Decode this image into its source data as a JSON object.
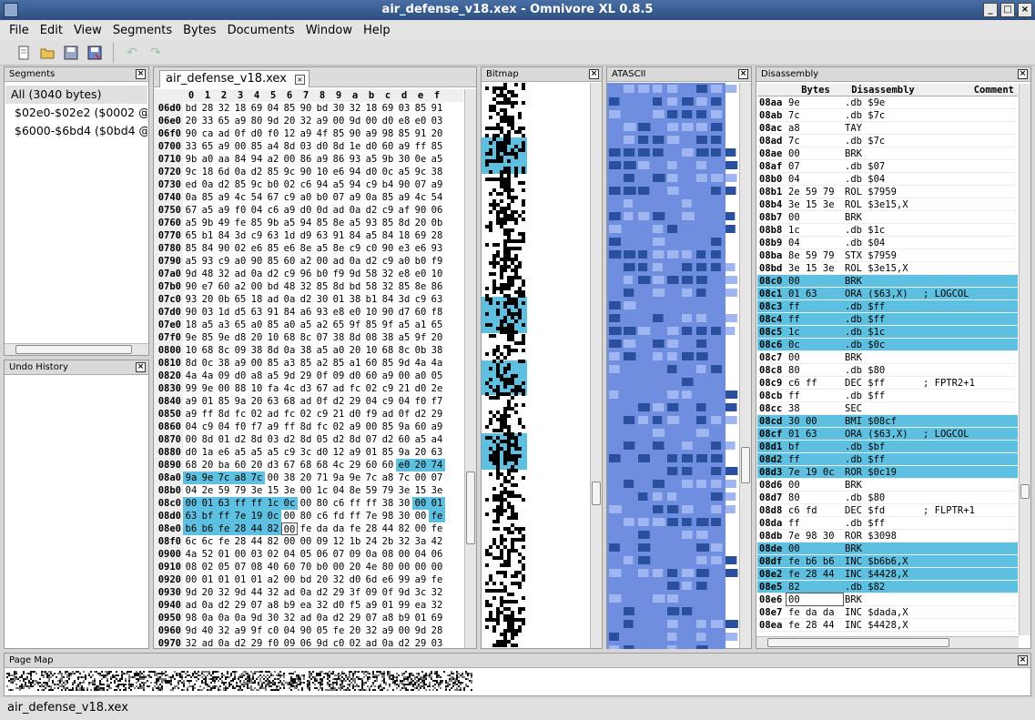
{
  "window": {
    "title": "air_defense_v18.xex - Omnivore XL 0.8.5"
  },
  "menu": [
    "File",
    "Edit",
    "View",
    "Segments",
    "Bytes",
    "Documents",
    "Window",
    "Help"
  ],
  "panels": {
    "segments": "Segments",
    "undo": "Undo History",
    "bitmap": "Bitmap",
    "atascii": "ATASCII",
    "disassembly": "Disassembly",
    "pagemap": "Page Map"
  },
  "segments": [
    "All (3040 bytes)",
    "$02e0-$02e2 ($0002 @",
    "$6000-$6bd4 ($0bd4 @"
  ],
  "editor_tab": "air_defense_v18.xex",
  "hex_columns": [
    "0",
    "1",
    "2",
    "3",
    "4",
    "5",
    "6",
    "7",
    "8",
    "9",
    "a",
    "b",
    "c",
    "d",
    "e",
    "f"
  ],
  "hex_rows": [
    {
      "addr": "06d0",
      "bytes": "bd 28 32 18 69 04 85 90 bd 30 32 18 69 03 85 91"
    },
    {
      "addr": "06e0",
      "bytes": "20 33 65 a9 80 9d 20 32 a9 00 9d 00 d0 e8 e0 03"
    },
    {
      "addr": "06f0",
      "bytes": "90 ca ad 0f d0 f0 12 a9 4f 85 90 a9 98 85 91 20"
    },
    {
      "addr": "0700",
      "bytes": "33 65 a9 00 85 a4 8d 03 d0 8d 1e d0 60 a9 ff 85"
    },
    {
      "addr": "0710",
      "bytes": "9b a0 aa 84 94 a2 00 86 a9 86 93 a5 9b 30 0e a5"
    },
    {
      "addr": "0720",
      "bytes": "9c 18 6d 0a d2 85 9c 90 10 e6 94 d0 0c a5 9c 38"
    },
    {
      "addr": "0730",
      "bytes": "ed 0a d2 85 9c b0 02 c6 94 a5 94 c9 b4 90 07 a9"
    },
    {
      "addr": "0740",
      "bytes": "0a 85 a9 4c 54 67 c9 a0 b0 07 a9 0a 85 a9 4c 54"
    },
    {
      "addr": "0750",
      "bytes": "67 a5 a9 f0 04 c6 a9 d0 0d ad 0a d2 c9 af 90 06"
    },
    {
      "addr": "0760",
      "bytes": "a5 9b 49 fe 85 9b a5 94 85 8e a5 93 85 8d 20 0b"
    },
    {
      "addr": "0770",
      "bytes": "65 b1 84 3d c9 63 1d d9 63 91 84 a5 84 18 69 28"
    },
    {
      "addr": "0780",
      "bytes": "85 84 90 02 e6 85 e6 8e a5 8e c9 c0 90 e3 e6 93"
    },
    {
      "addr": "0790",
      "bytes": "a5 93 c9 a0 90 85 60 a2 00 ad 0a d2 c9 a0 b0 f9"
    },
    {
      "addr": "07a0",
      "bytes": "9d 48 32 ad 0a d2 c9 96 b0 f9 9d 58 32 e8 e0 10"
    },
    {
      "addr": "07b0",
      "bytes": "90 e7 60 a2 00 bd 48 32 85 8d bd 58 32 85 8e 86"
    },
    {
      "addr": "07c0",
      "bytes": "93 20 0b 65 18 ad 0a d2 30 01 38 b1 84 3d c9 63"
    },
    {
      "addr": "07d0",
      "bytes": "90 03 1d d5 63 91 84 a6 93 e8 e0 10 90 d7 60 f8"
    },
    {
      "addr": "07e0",
      "bytes": "18 a5 a3 65 a0 85 a0 a5 a2 65 9f 85 9f a5 a1 65"
    },
    {
      "addr": "07f0",
      "bytes": "9e 85 9e d8 20 10 68 8c 07 38 8d 08 38 a5 9f 20"
    },
    {
      "addr": "0800",
      "bytes": "10 68 8c 09 38 8d 0a 38 a5 a0 20 10 68 8c 0b 38"
    },
    {
      "addr": "0810",
      "bytes": "8d 0c 38 a9 00 85 a3 85 a2 85 a1 60 85 9d 4a 4a"
    },
    {
      "addr": "0820",
      "bytes": "4a 4a 09 d0 a8 a5 9d 29 0f 09 d0 60 a9 00 a0 05"
    },
    {
      "addr": "0830",
      "bytes": "99 9e 00 88 10 fa 4c d3 67 ad fc 02 c9 21 d0 2e"
    },
    {
      "addr": "0840",
      "bytes": "a9 01 85 9a 20 63 68 ad 0f d2 29 04 c9 04 f0 f7"
    },
    {
      "addr": "0850",
      "bytes": "a9 ff 8d fc 02 ad fc 02 c9 21 d0 f9 ad 0f d2 29"
    },
    {
      "addr": "0860",
      "bytes": "04 c9 04 f0 f7 a9 ff 8d fc 02 a9 00 85 9a 60 a9"
    },
    {
      "addr": "0870",
      "bytes": "00 8d 01 d2 8d 03 d2 8d 05 d2 8d 07 d2 60 a5 a4"
    },
    {
      "addr": "0880",
      "bytes": "d0 1a e6 a5 a5 a5 c9 3c d0 12 a9 01 85 9a 20 63"
    },
    {
      "addr": "0890",
      "bytes": "68 20 ba 60 20 d3 67 68 68 4c 29 60 60 e0 20 74"
    },
    {
      "addr": "08a0",
      "bytes": "9a 9e 7c a8 7c 00 38 20 71 9a 9e 7c a8 7c 00 07"
    },
    {
      "addr": "08b0",
      "bytes": "04 2e 59 79 3e 15 3e 00 1c 04 8e 59 79 3e 15 3e"
    },
    {
      "addr": "08c0",
      "bytes": "00 01 63 ff ff 1c 0c 00 80 c6 ff ff 38 30 00 01"
    },
    {
      "addr": "08d0",
      "bytes": "63 bf ff 7e 19 0c 00 80 c6 fd ff 7e 98 30 00 fe"
    },
    {
      "addr": "08e0",
      "bytes": "b6 b6 fe 28 44 82 00 fe da da fe 28 44 82 00 fe"
    },
    {
      "addr": "08f0",
      "bytes": "6c 6c fe 28 44 82 00 00 09 12 1b 24 2b 32 3a 42"
    },
    {
      "addr": "0900",
      "bytes": "4a 52 01 00 03 02 04 05 06 07 09 0a 08 00 04 06"
    },
    {
      "addr": "0910",
      "bytes": "08 02 05 07 08 40 60 70 b0 00 20 4e 80 00 00 00"
    },
    {
      "addr": "0920",
      "bytes": "00 01 01 01 01 a2 00 bd 20 32 d0 6d e6 99 a9 fe"
    },
    {
      "addr": "0930",
      "bytes": "9d 20 32 9d 44 32 ad 0a d2 29 3f 09 0f 9d 3c 32"
    },
    {
      "addr": "0940",
      "bytes": "ad 0a d2 29 07 a8 b9 ea 32 d0 f5 a9 01 99 ea 32"
    },
    {
      "addr": "0950",
      "bytes": "98 0a 0a 0a 9d 30 32 ad 0a d2 29 07 a8 b9 01 69"
    },
    {
      "addr": "0960",
      "bytes": "9d 40 32 a9 9f c0 04 90 05 fe 20 32 a9 00 9d 28"
    },
    {
      "addr": "0970",
      "bytes": "32 ad 0a d2 29 f0 09 06 9d c0 02 ad 0a d2 29 03"
    }
  ],
  "dis_headers": {
    "addr": "",
    "bytes": "Bytes",
    "dis": "Disassembly",
    "comment": "Comment"
  },
  "dis_rows": [
    {
      "addr": "08aa",
      "bytes": "9e",
      "dis": ".db $9e",
      "comment": ""
    },
    {
      "addr": "08ab",
      "bytes": "7c",
      "dis": ".db $7c",
      "comment": ""
    },
    {
      "addr": "08ac",
      "bytes": "a8",
      "dis": "TAY",
      "comment": ""
    },
    {
      "addr": "08ad",
      "bytes": "7c",
      "dis": ".db $7c",
      "comment": ""
    },
    {
      "addr": "08ae",
      "bytes": "00",
      "dis": "BRK",
      "comment": ""
    },
    {
      "addr": "08af",
      "bytes": "07",
      "dis": ".db $07",
      "comment": ""
    },
    {
      "addr": "08b0",
      "bytes": "04",
      "dis": ".db $04",
      "comment": ""
    },
    {
      "addr": "08b1",
      "bytes": "2e 59 79",
      "dis": "ROL $7959",
      "comment": ""
    },
    {
      "addr": "08b4",
      "bytes": "3e 15 3e",
      "dis": "ROL $3e15,X",
      "comment": ""
    },
    {
      "addr": "08b7",
      "bytes": "00",
      "dis": "BRK",
      "comment": ""
    },
    {
      "addr": "08b8",
      "bytes": "1c",
      "dis": ".db $1c",
      "comment": ""
    },
    {
      "addr": "08b9",
      "bytes": "04",
      "dis": ".db $04",
      "comment": ""
    },
    {
      "addr": "08ba",
      "bytes": "8e 59 79",
      "dis": "STX $7959",
      "comment": ""
    },
    {
      "addr": "08bd",
      "bytes": "3e 15 3e",
      "dis": "ROL $3e15,X",
      "comment": ""
    },
    {
      "addr": "08c0",
      "bytes": "00",
      "dis": "BRK",
      "comment": ""
    },
    {
      "addr": "08c1",
      "bytes": "01 63",
      "dis": "ORA ($63,X)",
      "comment": "; LOGCOL"
    },
    {
      "addr": "08c3",
      "bytes": "ff",
      "dis": ".db $ff",
      "comment": ""
    },
    {
      "addr": "08c4",
      "bytes": "ff",
      "dis": ".db $ff",
      "comment": ""
    },
    {
      "addr": "08c5",
      "bytes": "1c",
      "dis": ".db $1c",
      "comment": ""
    },
    {
      "addr": "08c6",
      "bytes": "0c",
      "dis": ".db $0c",
      "comment": ""
    },
    {
      "addr": "08c7",
      "bytes": "00",
      "dis": "BRK",
      "comment": ""
    },
    {
      "addr": "08c8",
      "bytes": "80",
      "dis": ".db $80",
      "comment": ""
    },
    {
      "addr": "08c9",
      "bytes": "c6 ff",
      "dis": "DEC $ff",
      "comment": "; FPTR2+1"
    },
    {
      "addr": "08cb",
      "bytes": "ff",
      "dis": ".db $ff",
      "comment": ""
    },
    {
      "addr": "08cc",
      "bytes": "38",
      "dis": "SEC",
      "comment": ""
    },
    {
      "addr": "08cd",
      "bytes": "30 00",
      "dis": "BMI $08cf",
      "comment": ""
    },
    {
      "addr": "08cf",
      "bytes": "01 63",
      "dis": "ORA ($63,X)",
      "comment": "; LOGCOL"
    },
    {
      "addr": "08d1",
      "bytes": "bf",
      "dis": ".db $bf",
      "comment": ""
    },
    {
      "addr": "08d2",
      "bytes": "ff",
      "dis": ".db $ff",
      "comment": ""
    },
    {
      "addr": "08d3",
      "bytes": "7e 19 0c",
      "dis": "ROR $0c19",
      "comment": ""
    },
    {
      "addr": "08d6",
      "bytes": "00",
      "dis": "BRK",
      "comment": ""
    },
    {
      "addr": "08d7",
      "bytes": "80",
      "dis": ".db $80",
      "comment": ""
    },
    {
      "addr": "08d8",
      "bytes": "c6 fd",
      "dis": "DEC $fd",
      "comment": "; FLPTR+1"
    },
    {
      "addr": "08da",
      "bytes": "ff",
      "dis": ".db $ff",
      "comment": ""
    },
    {
      "addr": "08db",
      "bytes": "7e 98 30",
      "dis": "ROR $3098",
      "comment": ""
    },
    {
      "addr": "08de",
      "bytes": "00",
      "dis": "BRK",
      "comment": ""
    },
    {
      "addr": "08df",
      "bytes": "fe b6 b6",
      "dis": "INC $b6b6,X",
      "comment": ""
    },
    {
      "addr": "08e2",
      "bytes": "fe 28 44",
      "dis": "INC $4428,X",
      "comment": ""
    },
    {
      "addr": "08e5",
      "bytes": "82",
      "dis": ".db $82",
      "comment": ""
    },
    {
      "addr": "08e6",
      "bytes": "00",
      "dis": "BRK",
      "comment": ""
    },
    {
      "addr": "08e7",
      "bytes": "fe da da",
      "dis": "INC $dada,X",
      "comment": ""
    },
    {
      "addr": "08ea",
      "bytes": "fe 28 44",
      "dis": "INC $4428,X",
      "comment": ""
    }
  ],
  "status": "air_defense_v18.xex",
  "colors": {
    "highlight": "#5ec0e0",
    "atascii_bg": "#6f8ee0",
    "atascii_fg": "#2a4f9c"
  }
}
